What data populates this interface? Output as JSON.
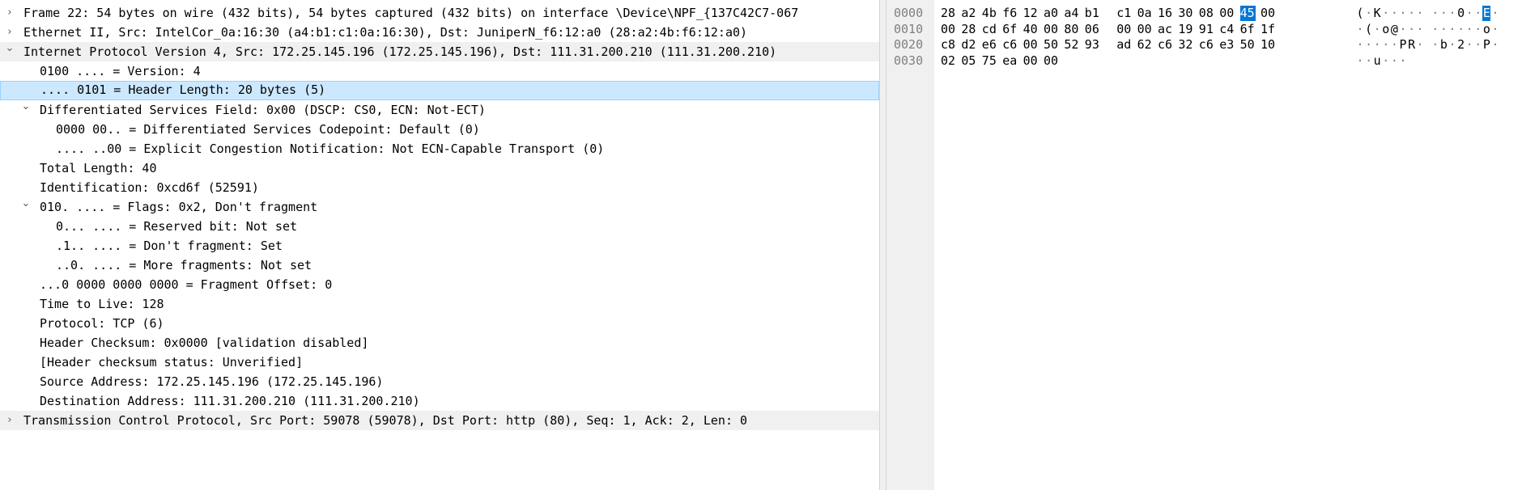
{
  "tree": [
    {
      "text": "Frame 22: 54 bytes on wire (432 bits), 54 bytes captured (432 bits) on interface \\Device\\NPF_{137C42C7-067",
      "level": 0,
      "state": "collapsed",
      "selected": false,
      "highlight": false
    },
    {
      "text": "Ethernet II, Src: IntelCor_0a:16:30 (a4:b1:c1:0a:16:30), Dst: JuniperN_f6:12:a0 (28:a2:4b:f6:12:a0)",
      "level": 0,
      "state": "collapsed",
      "selected": false,
      "highlight": false
    },
    {
      "text": "Internet Protocol Version 4, Src: 172.25.145.196 (172.25.145.196), Dst: 111.31.200.210 (111.31.200.210)",
      "level": 0,
      "state": "expanded",
      "selected": false,
      "highlight": true
    },
    {
      "text": "0100 .... = Version: 4",
      "level": 1,
      "state": "leaf",
      "selected": false,
      "highlight": false
    },
    {
      "text": ".... 0101 = Header Length: 20 bytes (5)",
      "level": 1,
      "state": "leaf",
      "selected": true,
      "highlight": false
    },
    {
      "text": "Differentiated Services Field: 0x00 (DSCP: CS0, ECN: Not-ECT)",
      "level": 1,
      "state": "expanded",
      "selected": false,
      "highlight": false
    },
    {
      "text": "0000 00.. = Differentiated Services Codepoint: Default (0)",
      "level": 2,
      "state": "leaf",
      "selected": false,
      "highlight": false
    },
    {
      "text": ".... ..00 = Explicit Congestion Notification: Not ECN-Capable Transport (0)",
      "level": 2,
      "state": "leaf",
      "selected": false,
      "highlight": false
    },
    {
      "text": "Total Length: 40",
      "level": 1,
      "state": "leaf",
      "selected": false,
      "highlight": false
    },
    {
      "text": "Identification: 0xcd6f (52591)",
      "level": 1,
      "state": "leaf",
      "selected": false,
      "highlight": false
    },
    {
      "text": "010. .... = Flags: 0x2, Don't fragment",
      "level": 1,
      "state": "expanded",
      "selected": false,
      "highlight": false
    },
    {
      "text": "0... .... = Reserved bit: Not set",
      "level": 2,
      "state": "leaf",
      "selected": false,
      "highlight": false
    },
    {
      "text": ".1.. .... = Don't fragment: Set",
      "level": 2,
      "state": "leaf",
      "selected": false,
      "highlight": false
    },
    {
      "text": "..0. .... = More fragments: Not set",
      "level": 2,
      "state": "leaf",
      "selected": false,
      "highlight": false
    },
    {
      "text": "...0 0000 0000 0000 = Fragment Offset: 0",
      "level": 1,
      "state": "leaf",
      "selected": false,
      "highlight": false
    },
    {
      "text": "Time to Live: 128",
      "level": 1,
      "state": "leaf",
      "selected": false,
      "highlight": false
    },
    {
      "text": "Protocol: TCP (6)",
      "level": 1,
      "state": "leaf",
      "selected": false,
      "highlight": false
    },
    {
      "text": "Header Checksum: 0x0000 [validation disabled]",
      "level": 1,
      "state": "leaf",
      "selected": false,
      "highlight": false
    },
    {
      "text": "[Header checksum status: Unverified]",
      "level": 1,
      "state": "leaf",
      "selected": false,
      "highlight": false
    },
    {
      "text": "Source Address: 172.25.145.196 (172.25.145.196)",
      "level": 1,
      "state": "leaf",
      "selected": false,
      "highlight": false
    },
    {
      "text": "Destination Address: 111.31.200.210 (111.31.200.210)",
      "level": 1,
      "state": "leaf",
      "selected": false,
      "highlight": false
    },
    {
      "text": "Transmission Control Protocol, Src Port: 59078 (59078), Dst Port: http (80), Seq: 1, Ack: 2, Len: 0",
      "level": 0,
      "state": "collapsed",
      "selected": false,
      "highlight": true
    }
  ],
  "hex": [
    {
      "offset": "0000",
      "bytes": [
        "28",
        "a2",
        "4b",
        "f6",
        "12",
        "a0",
        "a4",
        "b1",
        "c1",
        "0a",
        "16",
        "30",
        "08",
        "00",
        "45",
        "00"
      ],
      "ascii": [
        "(",
        "·",
        "K",
        "·",
        "·",
        "·",
        "·",
        "·",
        "·",
        "·",
        "·",
        "0",
        "·",
        "·",
        "E",
        "·"
      ]
    },
    {
      "offset": "0010",
      "bytes": [
        "00",
        "28",
        "cd",
        "6f",
        "40",
        "00",
        "80",
        "06",
        "00",
        "00",
        "ac",
        "19",
        "91",
        "c4",
        "6f",
        "1f"
      ],
      "ascii": [
        "·",
        "(",
        "·",
        "o",
        "@",
        "·",
        "·",
        "·",
        "·",
        "·",
        "·",
        "·",
        "·",
        "·",
        "o",
        "·"
      ]
    },
    {
      "offset": "0020",
      "bytes": [
        "c8",
        "d2",
        "e6",
        "c6",
        "00",
        "50",
        "52",
        "93",
        "ad",
        "62",
        "c6",
        "32",
        "c6",
        "e3",
        "50",
        "10"
      ],
      "ascii": [
        "·",
        "·",
        "·",
        "·",
        "·",
        "P",
        "R",
        "·",
        "·",
        "b",
        "·",
        "2",
        "·",
        "·",
        "P",
        "·"
      ]
    },
    {
      "offset": "0030",
      "bytes": [
        "02",
        "05",
        "75",
        "ea",
        "00",
        "00"
      ],
      "ascii": [
        "·",
        "·",
        "u",
        "·",
        "·",
        "·"
      ]
    }
  ],
  "hex_selection": {
    "row": 0,
    "col": 14
  },
  "icons": {
    "collapsed": "chevron-right-icon",
    "expanded": "chevron-down-icon"
  },
  "colors": {
    "selected_row_bg": "#cce8ff",
    "selected_byte_bg": "#0078d7",
    "protocol_row_bg": "#f0f0f0"
  }
}
